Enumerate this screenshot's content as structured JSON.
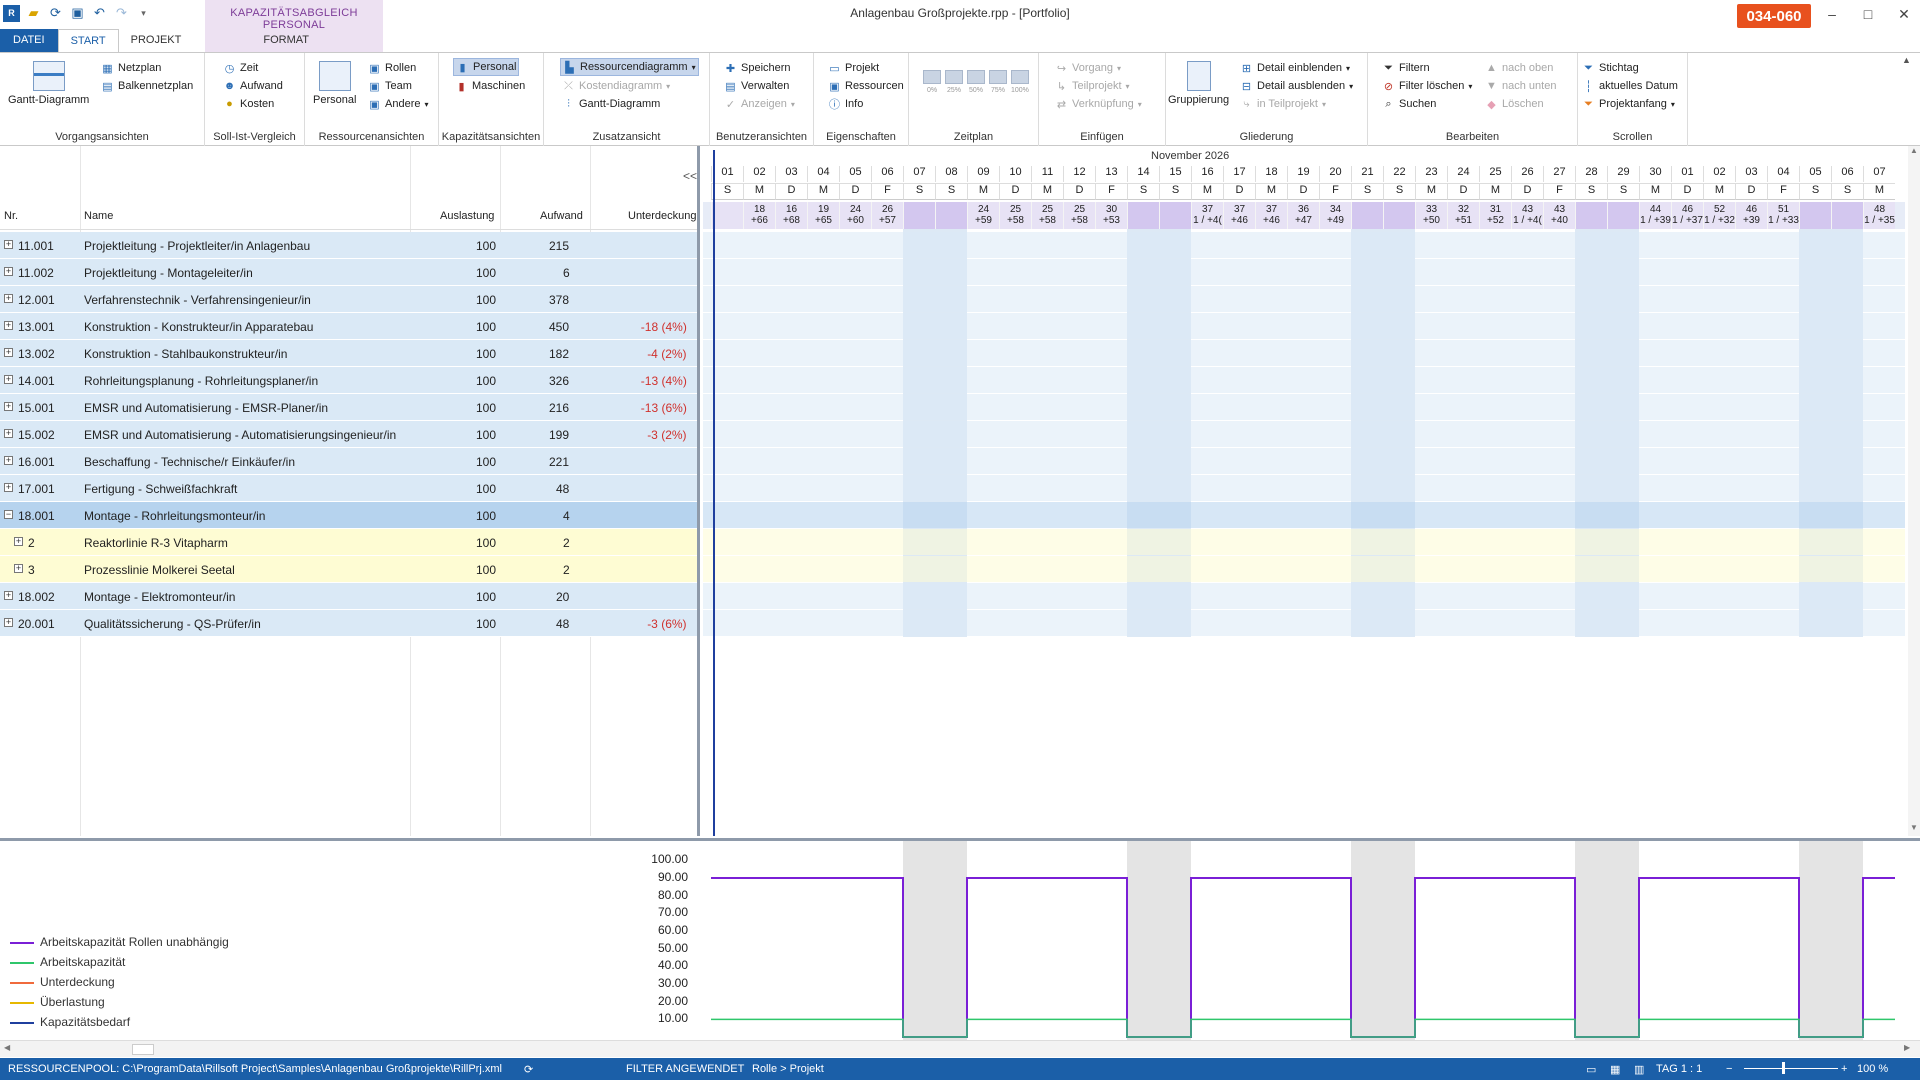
{
  "window": {
    "title": "Anlagenbau Großprojekte.rpp - [Portfolio]",
    "badge": "034-060",
    "context_tab": "KAPAZITÄTSABGLEICH PERSONAL",
    "min": "–",
    "max": "□",
    "close": "✕"
  },
  "tabs": {
    "file": "DATEI",
    "start": "START",
    "project": "PROJEKT",
    "format": "FORMAT"
  },
  "ribbon": {
    "g1": {
      "label": "Vorgangsansichten",
      "gantt": "Gantt-Diagramm",
      "netzplan": "Netzplan",
      "balken": "Balkennetzplan"
    },
    "g2": {
      "label": "Soll-Ist-Vergleich",
      "zeit": "Zeit",
      "aufwand": "Aufwand",
      "kosten": "Kosten"
    },
    "g3": {
      "label": "Ressourcenansichten",
      "personal": "Personal",
      "rollen": "Rollen",
      "team": "Team",
      "andere": "Andere"
    },
    "g4": {
      "label": "Kapazitätsansichten",
      "personal": "Personal",
      "maschinen": "Maschinen"
    },
    "g5": {
      "label": "Zusatzansicht",
      "ress": "Ressourcendiagramm",
      "kosten": "Kostendiagramm",
      "gantt": "Gantt-Diagramm"
    },
    "g6": {
      "label": "Benutzeransichten",
      "speichern": "Speichern",
      "verwalten": "Verwalten",
      "anzeigen": "Anzeigen"
    },
    "g7": {
      "label": "Eigenschaften",
      "projekt": "Projekt",
      "ressourcen": "Ressourcen",
      "info": "Info"
    },
    "g8": {
      "label": "Zeitplan",
      "z0": "0%",
      "z25": "25%",
      "z50": "50%",
      "z75": "75%",
      "z100": "100%"
    },
    "g9": {
      "label": "Einfügen",
      "vorgang": "Vorgang",
      "teilprojekt": "Teilprojekt",
      "verk": "Verknüpfung"
    },
    "g10": {
      "label": "Gliederung",
      "grupp": "Gruppierung",
      "einblenden": "Detail einblenden",
      "ausblenden": "Detail ausblenden",
      "inteil": "in Teilprojekt"
    },
    "g11": {
      "label": "Bearbeiten",
      "filtern": "Filtern",
      "filterl": "Filter löschen",
      "suchen": "Suchen",
      "oben": "nach oben",
      "unten": "nach unten",
      "loeschen": "Löschen"
    },
    "g12": {
      "label": "Scrollen",
      "stichtag": "Stichtag",
      "aktuell": "aktuelles Datum",
      "anfang": "Projektanfang"
    }
  },
  "table": {
    "headers": {
      "nr": "Nr.",
      "name": "Name",
      "auslastung": "Auslastung",
      "aufwand": "Aufwand",
      "unterdeckung": "Unterdeckung"
    },
    "collapse": "<<",
    "rows": [
      {
        "nr": "11.001",
        "name": "Projektleitung - Projektleiter/in Anlagenbau",
        "ausl": "100",
        "aufw": "215",
        "unter": "",
        "style": "blue",
        "indent": 0,
        "exp": "+"
      },
      {
        "nr": "11.002",
        "name": "Projektleitung - Montageleiter/in",
        "ausl": "100",
        "aufw": "6",
        "unter": "",
        "style": "blue",
        "indent": 0,
        "exp": "+"
      },
      {
        "nr": "12.001",
        "name": "Verfahrenstechnik - Verfahrensingenieur/in",
        "ausl": "100",
        "aufw": "378",
        "unter": "",
        "style": "blue",
        "indent": 0,
        "exp": "+"
      },
      {
        "nr": "13.001",
        "name": "Konstruktion - Konstrukteur/in Apparatebau",
        "ausl": "100",
        "aufw": "450",
        "unter": "-18 (4%)",
        "style": "blue",
        "indent": 0,
        "exp": "+"
      },
      {
        "nr": "13.002",
        "name": "Konstruktion - Stahlbaukonstrukteur/in",
        "ausl": "100",
        "aufw": "182",
        "unter": "-4 (2%)",
        "style": "blue",
        "indent": 0,
        "exp": "+"
      },
      {
        "nr": "14.001",
        "name": "Rohrleitungsplanung - Rohrleitungsplaner/in",
        "ausl": "100",
        "aufw": "326",
        "unter": "-13 (4%)",
        "style": "blue",
        "indent": 0,
        "exp": "+"
      },
      {
        "nr": "15.001",
        "name": "EMSR und Automatisierung - EMSR-Planer/in",
        "ausl": "100",
        "aufw": "216",
        "unter": "-13 (6%)",
        "style": "blue",
        "indent": 0,
        "exp": "+"
      },
      {
        "nr": "15.002",
        "name": "EMSR und Automatisierung - Automatisierungsingenieur/in",
        "ausl": "100",
        "aufw": "199",
        "unter": "-3 (2%)",
        "style": "blue",
        "indent": 0,
        "exp": "+"
      },
      {
        "nr": "16.001",
        "name": "Beschaffung - Technische/r Einkäufer/in",
        "ausl": "100",
        "aufw": "221",
        "unter": "",
        "style": "blue",
        "indent": 0,
        "exp": "+"
      },
      {
        "nr": "17.001",
        "name": "Fertigung - Schweißfachkraft",
        "ausl": "100",
        "aufw": "48",
        "unter": "",
        "style": "blue",
        "indent": 0,
        "exp": "+"
      },
      {
        "nr": "18.001",
        "name": "Montage - Rohrleitungsmonteur/in",
        "ausl": "100",
        "aufw": "4",
        "unter": "",
        "style": "sel",
        "indent": 0,
        "exp": "−"
      },
      {
        "nr": "2",
        "name": "Reaktorlinie R-3 Vitapharm",
        "ausl": "100",
        "aufw": "2",
        "unter": "",
        "style": "yellow",
        "indent": 1,
        "exp": "+"
      },
      {
        "nr": "3",
        "name": "Prozesslinie Molkerei Seetal",
        "ausl": "100",
        "aufw": "2",
        "unter": "",
        "style": "yellow",
        "indent": 1,
        "exp": "+"
      },
      {
        "nr": "18.002",
        "name": "Montage - Elektromonteur/in",
        "ausl": "100",
        "aufw": "20",
        "unter": "",
        "style": "blue",
        "indent": 0,
        "exp": "+"
      },
      {
        "nr": "20.001",
        "name": "Qualitätssicherung - QS-Prüfer/in",
        "ausl": "100",
        "aufw": "48",
        "unter": "-3 (6%)",
        "style": "blue",
        "indent": 0,
        "exp": "+"
      }
    ]
  },
  "gantt": {
    "month": "November 2026",
    "days": [
      "01",
      "02",
      "03",
      "04",
      "05",
      "06",
      "07",
      "08",
      "09",
      "10",
      "11",
      "12",
      "13",
      "14",
      "15",
      "16",
      "17",
      "18",
      "19",
      "20",
      "21",
      "22",
      "23",
      "24",
      "25",
      "26",
      "27",
      "28",
      "29",
      "30",
      "01",
      "02",
      "03",
      "04",
      "05",
      "06",
      "07"
    ],
    "wd": [
      "S",
      "M",
      "D",
      "M",
      "D",
      "F",
      "S",
      "S",
      "M",
      "D",
      "M",
      "D",
      "F",
      "S",
      "S",
      "M",
      "D",
      "M",
      "D",
      "F",
      "S",
      "S",
      "M",
      "D",
      "M",
      "D",
      "F",
      "S",
      "S",
      "M",
      "D",
      "M",
      "D",
      "F",
      "S",
      "S",
      "M"
    ],
    "summary": {
      "2": [
        "18",
        "+66"
      ],
      "3": [
        "16",
        "+68"
      ],
      "4": [
        "19",
        "+65"
      ],
      "5": [
        "24",
        "+60"
      ],
      "6": [
        "26",
        "+57"
      ],
      "9": [
        "24",
        "+59"
      ],
      "10": [
        "25",
        "+58"
      ],
      "11": [
        "25",
        "+58"
      ],
      "12": [
        "25",
        "+58"
      ],
      "13": [
        "30",
        "+53"
      ],
      "16": [
        "37",
        "1 / +4("
      ],
      "17": [
        "37",
        "+46"
      ],
      "18": [
        "37",
        "+46"
      ],
      "19": [
        "36",
        "+47"
      ],
      "20": [
        "34",
        "+49"
      ],
      "23": [
        "33",
        "+50"
      ],
      "24": [
        "32",
        "+51"
      ],
      "25": [
        "31",
        "+52"
      ],
      "26": [
        "43",
        "1 / +4("
      ],
      "27": [
        "43",
        "+40"
      ],
      "30": [
        "44",
        "1 / +39"
      ],
      "31": [
        "46",
        "1 / +37"
      ],
      "32": [
        "52",
        "1 / +32"
      ],
      "33": [
        "46",
        "+39"
      ],
      "34": [
        "51",
        "1 / +33"
      ],
      "37": [
        "48",
        "1 / +35"
      ]
    }
  },
  "chart": {
    "yticks": [
      "100.00",
      "90.00",
      "80.00",
      "70.00",
      "60.00",
      "50.00",
      "40.00",
      "30.00",
      "20.00",
      "10.00"
    ],
    "legend": [
      {
        "name": "Arbeitskapazität Rollen unabhängig",
        "color": "#7a1fd6"
      },
      {
        "name": "Arbeitskapazität",
        "color": "#2fc66b"
      },
      {
        "name": "Unterdeckung",
        "color": "#f06a3c"
      },
      {
        "name": "Überlastung",
        "color": "#e6b800"
      },
      {
        "name": "Kapazitätsbedarf",
        "color": "#1f3f9e"
      }
    ]
  },
  "chart_data": {
    "type": "line",
    "x_unit": "day",
    "ylim": [
      0,
      100
    ],
    "series": [
      {
        "name": "Arbeitskapazität Rollen unabhängig",
        "weekday_value": 90,
        "weekend_value": 0
      },
      {
        "name": "Arbeitskapazität",
        "weekday_value": 10,
        "weekend_value": 0
      }
    ]
  },
  "status": {
    "pool": "RESSOURCENPOOL: C:\\ProgramData\\Rillsoft Project\\Samples\\Anlagenbau Großprojekte\\RillPrj.xml",
    "filter": "FILTER ANGEWENDET",
    "view": "Rolle > Projekt",
    "tag": "TAG 1 : 1",
    "zoom": "100 %"
  }
}
